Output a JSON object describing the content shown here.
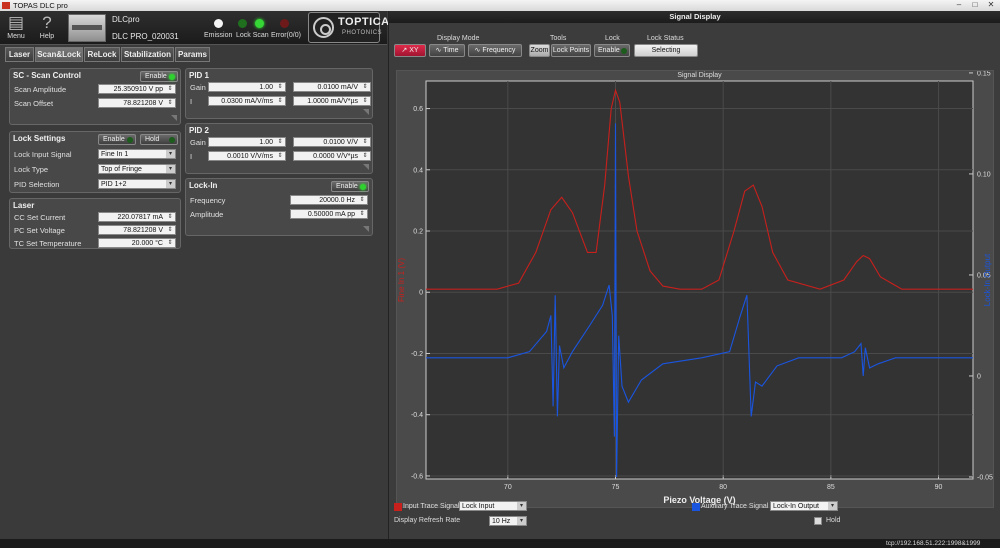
{
  "window": {
    "title": "TOPAS DLC pro"
  },
  "toolbar": {
    "menu": "Menu",
    "help": "Help"
  },
  "device": {
    "name": "DLCpro",
    "serial": "DLC PRO_020031"
  },
  "status_leds": {
    "emission": "Emission",
    "lock_scan": "Lock Scan",
    "error": "Error(0/0)"
  },
  "logo": {
    "brand": "TOPTICA",
    "sub": "PHOTONICS"
  },
  "tabs": [
    "Laser",
    "Scan&Lock",
    "ReLock",
    "Stabilization",
    "Params"
  ],
  "scan_control": {
    "title": "SC - Scan Control",
    "enable": "Enable",
    "amp_label": "Scan Amplitude",
    "amp_value": "25.350910 V pp",
    "offset_label": "Scan Offset",
    "offset_value": "78.821208 V"
  },
  "lock_settings": {
    "title": "Lock Settings",
    "enable": "Enable",
    "hold": "Hold",
    "input_label": "Lock Input Signal",
    "input_value": "Fine In 1",
    "type_label": "Lock Type",
    "type_value": "Top of Fringe",
    "pid_label": "PID Selection",
    "pid_value": "PID 1+2"
  },
  "laser": {
    "title": "Laser",
    "cc_label": "CC Set Current",
    "cc_value": "220.07817 mA",
    "pc_label": "PC Set Voltage",
    "pc_value": "78.821208 V",
    "tc_label": "TC Set Temperature",
    "tc_value": "20.000 °C"
  },
  "pid1": {
    "title": "PID 1",
    "gain_label": "Gain",
    "gain_value": "1.00",
    "gain2": "0.0100 mA/V",
    "i_label": "I",
    "i_value": "0.0300 mA/V/ms",
    "i2": "1.0000 mA/V*µs"
  },
  "pid2": {
    "title": "PID 2",
    "gain_label": "Gain",
    "gain_value": "1.00",
    "gain2": "0.0100 V/V",
    "i_label": "I",
    "i_value": "0.0010 V/V/ms",
    "i2": "0.0000 V/V*µs"
  },
  "lockin": {
    "title": "Lock-In",
    "enable": "Enable",
    "freq_label": "Frequency",
    "freq_value": "20000.0 Hz",
    "amp_label": "Amplitude",
    "amp_value": "0.50000 mA pp"
  },
  "signal_display": {
    "window_title": "Signal Display",
    "display_mode": "Display Mode",
    "tools": "Tools",
    "lock": "Lock",
    "lock_status": "Lock Status",
    "xy": "XY",
    "time": "Time",
    "frequency": "Frequency",
    "zoom": "Zoom",
    "lock_points": "Lock Points",
    "enable": "Enable",
    "selecting": "Selecting",
    "plot_title": "Signal Display",
    "input_trace_label": "Input Trace Signal",
    "input_trace_value": "Lock Input",
    "aux_trace_label": "Auxiliary Trace Signal",
    "aux_trace_value": "Lock-In Output",
    "refresh_label": "Display Refresh Rate",
    "refresh_value": "10 Hz",
    "hold": "Hold",
    "colors": {
      "input": "#c8201c",
      "aux": "#1a55e0"
    }
  },
  "chart_data": {
    "type": "line",
    "title": "Signal Display",
    "xlabel": "Piezo Voltage (V)",
    "ylabel": "Fine In 1 (V)",
    "y2label": "Lock-In Output",
    "xlim": [
      66.2,
      91.6
    ],
    "ylim": [
      -0.61,
      0.69
    ],
    "y2lim": [
      -0.051,
      0.146
    ],
    "xticks": [
      70,
      75,
      80,
      85,
      90
    ],
    "yticks": [
      0.6,
      0.4,
      0.2,
      0,
      -0.2,
      -0.4,
      -0.6
    ],
    "y2ticks": [
      0.15,
      0.1,
      0.05,
      0,
      -0.05
    ],
    "series": [
      {
        "name": "Input Trace Signal",
        "color": "#c8201c",
        "axis": "left",
        "x": [
          66.2,
          69.5,
          70.5,
          71.3,
          72.0,
          72.5,
          73.0,
          73.7,
          74.1,
          74.5,
          74.8,
          75.0,
          75.2,
          75.6,
          76.0,
          76.6,
          77.2,
          78.0,
          79.0,
          79.8,
          80.5,
          81.0,
          81.4,
          81.8,
          82.3,
          83.0,
          84.5,
          85.6,
          86.2,
          86.5,
          86.8,
          87.3,
          88.3,
          91.6
        ],
        "y": [
          0.01,
          0.01,
          0.03,
          0.13,
          0.27,
          0.31,
          0.26,
          0.13,
          0.13,
          0.35,
          0.6,
          0.66,
          0.62,
          0.38,
          0.2,
          0.07,
          0.02,
          0.01,
          0.01,
          0.04,
          0.2,
          0.33,
          0.35,
          0.28,
          0.13,
          0.04,
          0.01,
          0.04,
          0.1,
          0.12,
          0.11,
          0.05,
          0.01,
          0.01
        ]
      },
      {
        "name": "Auxiliary Trace Signal",
        "color": "#1a55e0",
        "axis": "right",
        "x": [
          66.2,
          70.0,
          71.0,
          71.8,
          72.0,
          72.1,
          72.2,
          72.3,
          72.4,
          72.6,
          73.0,
          73.8,
          74.4,
          74.7,
          74.85,
          74.95,
          75.0,
          75.05,
          75.15,
          75.3,
          75.6,
          76.2,
          77.2,
          79.0,
          80.3,
          80.8,
          81.1,
          81.3,
          81.5,
          81.8,
          82.5,
          83.5,
          85.5,
          86.1,
          86.4,
          86.5,
          86.6,
          86.8,
          87.2,
          88.0,
          91.6
        ],
        "y": [
          0.009,
          0.009,
          0.012,
          0.022,
          0.03,
          -0.015,
          0.04,
          -0.02,
          0.015,
          0.004,
          0.012,
          0.025,
          0.035,
          0.045,
          0.03,
          -0.03,
          0.125,
          -0.05,
          0.02,
          -0.005,
          -0.013,
          -0.002,
          0.006,
          0.009,
          0.012,
          0.03,
          0.04,
          -0.02,
          -0.003,
          -0.005,
          0.005,
          0.009,
          0.009,
          0.012,
          0.016,
          0.0,
          0.014,
          0.004,
          0.006,
          0.009,
          0.009
        ]
      }
    ]
  },
  "status": {
    "address": "tcp://192.168.51.222:1998&1999"
  }
}
